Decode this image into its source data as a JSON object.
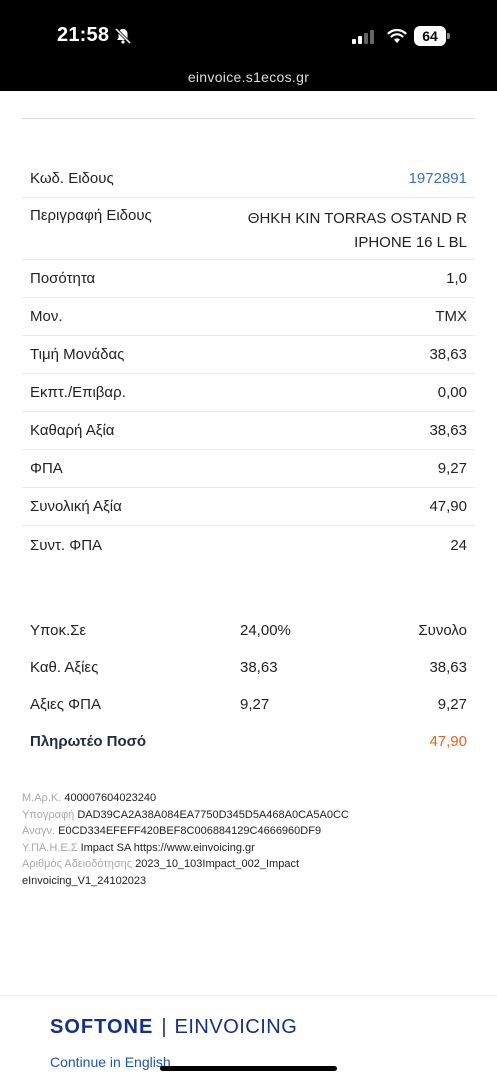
{
  "status": {
    "time": "21:58",
    "battery": "64",
    "url": "einvoice.s1ecos.gr"
  },
  "details": {
    "rows": [
      {
        "label": "Κωδ. Ειδους",
        "value": "1972891"
      },
      {
        "label": "Περιγραφή Ειδους",
        "value_line1": "ΘΗΚΗ KIN TORRAS OSTAND R",
        "value_line2": "IPHONE 16 L BL"
      },
      {
        "label": "Ποσότητα",
        "value": "1,0"
      },
      {
        "label": "Μον.",
        "value": "ΤΜΧ"
      },
      {
        "label": "Τιμή Μονάδας",
        "value": "38,63"
      },
      {
        "label": "Εκπτ./Επιβαρ.",
        "value": "0,00"
      },
      {
        "label": "Καθαρή Αξία",
        "value": "38,63"
      },
      {
        "label": "ΦΠΑ",
        "value": "9,27"
      },
      {
        "label": "Συνολική Αξία",
        "value": "47,90"
      },
      {
        "label": "Συντ. ΦΠΑ",
        "value": "24"
      }
    ]
  },
  "totals": {
    "header": {
      "c1": "Υποκ.Σε",
      "c2": "24,00%",
      "c3": "Συνολο"
    },
    "net": {
      "c1": "Καθ. Αξίες",
      "c2": "38,63",
      "c3": "38,63"
    },
    "vat": {
      "c1": "Αξιες ΦΠΑ",
      "c2": "9,27",
      "c3": "9,27"
    },
    "payable": {
      "label": "Πληρωτέο Ποσό",
      "value": "47,90"
    }
  },
  "info": {
    "mark_label": "Μ.Αρ.Κ.",
    "mark_value": "400007604023240",
    "sig_label": "Υπογραφή",
    "sig_value": "DAD39CA2A38A084EA7750D345D5A468A0CA5A0CC",
    "ref_label": "Αναγν.",
    "ref_value": "E0CD334EFEFF420BEF8C006884129C4666960DF9",
    "provider_label": "Υ.ΠΑ.Η.Ε.Σ",
    "provider_value": "Impact SA https://www.einvoicing.gr",
    "license_label": "Αριθμός Αδειοδότησης",
    "license_value": "2023_10_103Impact_002_Impact",
    "license_value2": "eInvoicing_V1_24102023"
  },
  "footer": {
    "brand": "SOFTONE",
    "separator": "|",
    "product": "EINVOICING",
    "continue_link": "Continue in English"
  },
  "colors": {
    "link": "#3b6fc4",
    "payable": "#e3651d",
    "brand": "#15308a"
  }
}
